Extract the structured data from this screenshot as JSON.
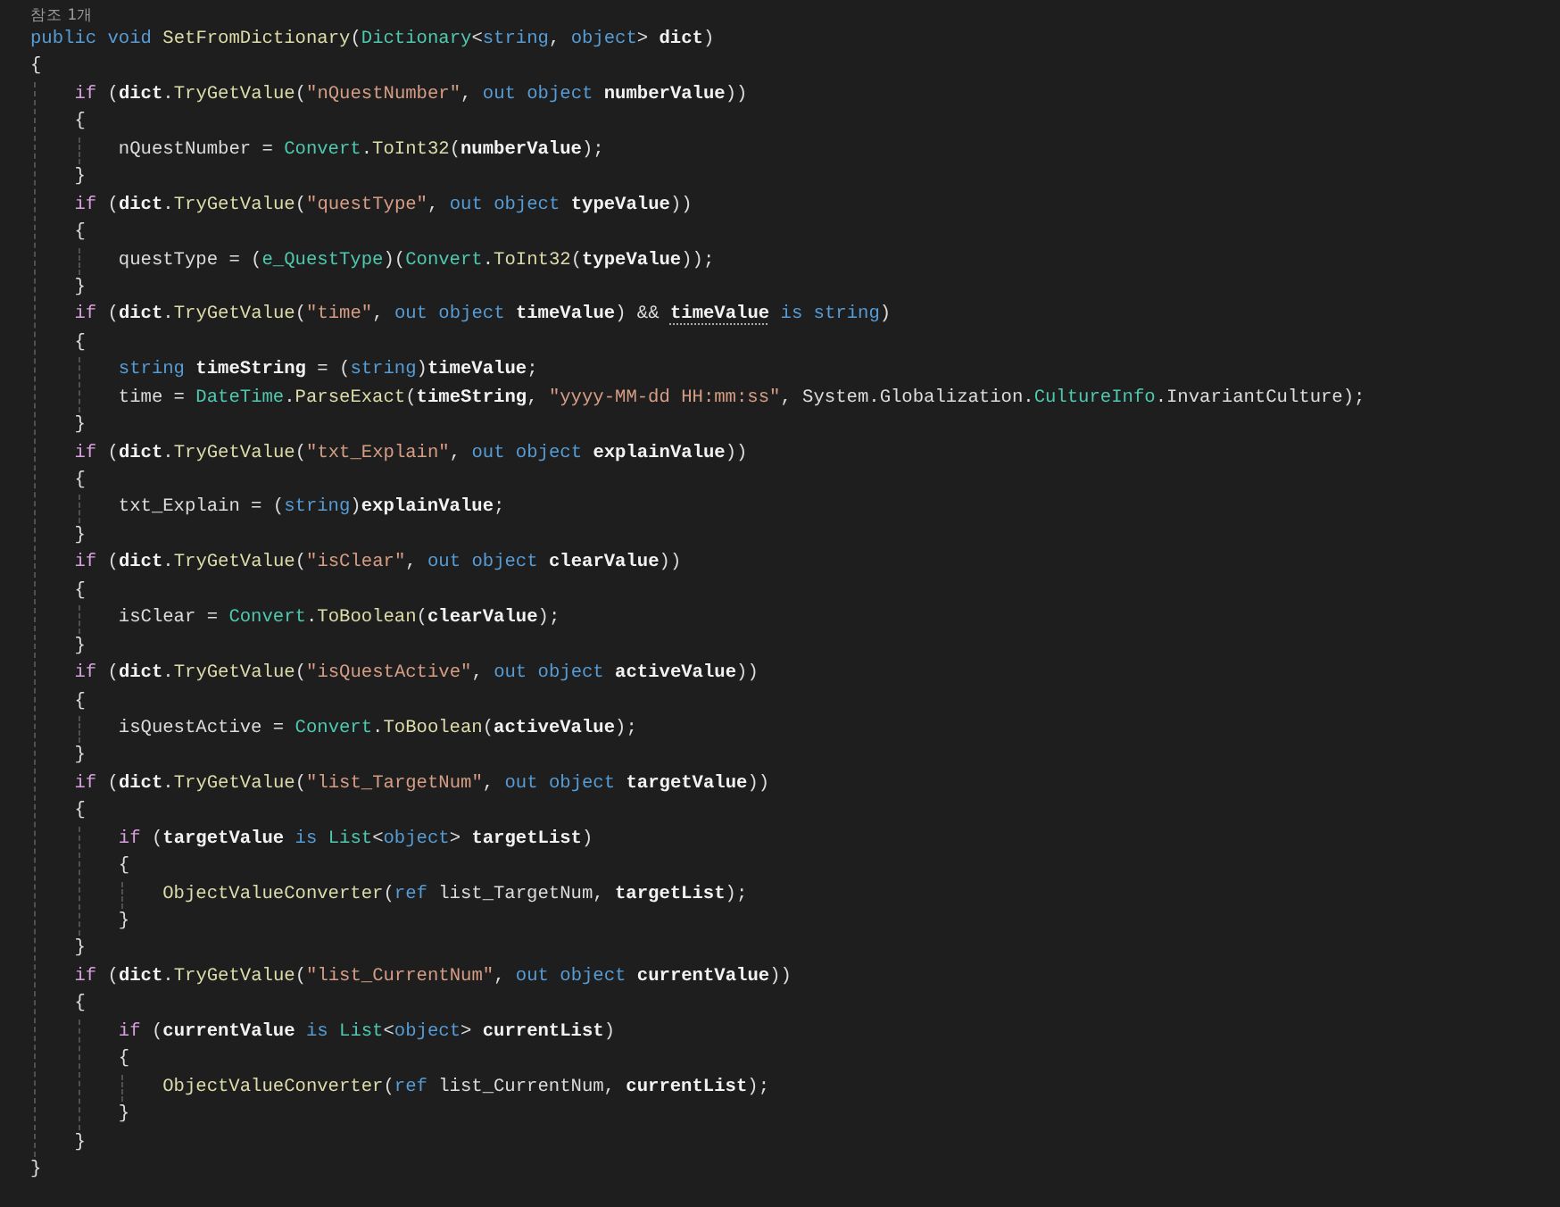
{
  "codelens": "참조 1개",
  "lines": [
    {
      "tokens": [
        {
          "kind": "kw",
          "text": "public void "
        },
        {
          "kind": "fn",
          "text": "SetFromDictionary"
        },
        {
          "kind": "plain",
          "text": "("
        },
        {
          "kind": "type",
          "text": "Dictionary"
        },
        {
          "kind": "plain",
          "text": "<"
        },
        {
          "kind": "kw",
          "text": "string"
        },
        {
          "kind": "plain",
          "text": ", "
        },
        {
          "kind": "kw",
          "text": "object"
        },
        {
          "kind": "plain",
          "text": "> "
        },
        {
          "kind": "var",
          "text": "dict"
        },
        {
          "kind": "plain",
          "text": ")"
        }
      ]
    },
    {
      "tokens": [
        {
          "kind": "plain",
          "text": "{"
        }
      ]
    },
    {
      "children": [
        {
          "tokens": [
            {
              "kind": "ctl",
              "text": "if "
            },
            {
              "kind": "plain",
              "text": "("
            },
            {
              "kind": "var",
              "text": "dict"
            },
            {
              "kind": "plain",
              "text": "."
            },
            {
              "kind": "fn",
              "text": "TryGetValue"
            },
            {
              "kind": "plain",
              "text": "("
            },
            {
              "kind": "str",
              "text": "\"nQuestNumber\""
            },
            {
              "kind": "plain",
              "text": ", "
            },
            {
              "kind": "kw",
              "text": "out object "
            },
            {
              "kind": "var",
              "text": "numberValue"
            },
            {
              "kind": "plain",
              "text": "))"
            }
          ]
        },
        {
          "tokens": [
            {
              "kind": "plain",
              "text": "{"
            }
          ]
        },
        {
          "children": [
            {
              "tokens": [
                {
                  "kind": "plain",
                  "text": "nQuestNumber = "
                },
                {
                  "kind": "type",
                  "text": "Convert"
                },
                {
                  "kind": "plain",
                  "text": "."
                },
                {
                  "kind": "fn",
                  "text": "ToInt32"
                },
                {
                  "kind": "plain",
                  "text": "("
                },
                {
                  "kind": "var",
                  "text": "numberValue"
                },
                {
                  "kind": "plain",
                  "text": ");"
                }
              ]
            }
          ]
        },
        {
          "tokens": [
            {
              "kind": "plain",
              "text": "}"
            }
          ]
        },
        {
          "tokens": [
            {
              "kind": "ctl",
              "text": "if "
            },
            {
              "kind": "plain",
              "text": "("
            },
            {
              "kind": "var",
              "text": "dict"
            },
            {
              "kind": "plain",
              "text": "."
            },
            {
              "kind": "fn",
              "text": "TryGetValue"
            },
            {
              "kind": "plain",
              "text": "("
            },
            {
              "kind": "str",
              "text": "\"questType\""
            },
            {
              "kind": "plain",
              "text": ", "
            },
            {
              "kind": "kw",
              "text": "out object "
            },
            {
              "kind": "var",
              "text": "typeValue"
            },
            {
              "kind": "plain",
              "text": "))"
            }
          ]
        },
        {
          "tokens": [
            {
              "kind": "plain",
              "text": "{"
            }
          ]
        },
        {
          "children": [
            {
              "tokens": [
                {
                  "kind": "plain",
                  "text": "questType = ("
                },
                {
                  "kind": "type",
                  "text": "e_QuestType"
                },
                {
                  "kind": "plain",
                  "text": ")("
                },
                {
                  "kind": "type",
                  "text": "Convert"
                },
                {
                  "kind": "plain",
                  "text": "."
                },
                {
                  "kind": "fn",
                  "text": "ToInt32"
                },
                {
                  "kind": "plain",
                  "text": "("
                },
                {
                  "kind": "var",
                  "text": "typeValue"
                },
                {
                  "kind": "plain",
                  "text": "));"
                }
              ]
            }
          ]
        },
        {
          "tokens": [
            {
              "kind": "plain",
              "text": "}"
            }
          ]
        },
        {
          "tokens": [
            {
              "kind": "ctl",
              "text": "if "
            },
            {
              "kind": "plain",
              "text": "("
            },
            {
              "kind": "var",
              "text": "dict"
            },
            {
              "kind": "plain",
              "text": "."
            },
            {
              "kind": "fn",
              "text": "TryGetValue"
            },
            {
              "kind": "plain",
              "text": "("
            },
            {
              "kind": "str",
              "text": "\"time\""
            },
            {
              "kind": "plain",
              "text": ", "
            },
            {
              "kind": "kw",
              "text": "out object "
            },
            {
              "kind": "var",
              "text": "timeValue"
            },
            {
              "kind": "plain",
              "text": ") && "
            },
            {
              "kind": "hint",
              "text": "timeValue"
            },
            {
              "kind": "kw",
              "text": " is string"
            },
            {
              "kind": "plain",
              "text": ")"
            }
          ]
        },
        {
          "tokens": [
            {
              "kind": "plain",
              "text": "{"
            }
          ]
        },
        {
          "children": [
            {
              "tokens": [
                {
                  "kind": "kw",
                  "text": "string "
                },
                {
                  "kind": "var",
                  "text": "timeString"
                },
                {
                  "kind": "plain",
                  "text": " = ("
                },
                {
                  "kind": "kw",
                  "text": "string"
                },
                {
                  "kind": "plain",
                  "text": ")"
                },
                {
                  "kind": "var",
                  "text": "timeValue"
                },
                {
                  "kind": "plain",
                  "text": ";"
                }
              ]
            },
            {
              "tokens": [
                {
                  "kind": "plain",
                  "text": "time = "
                },
                {
                  "kind": "type",
                  "text": "DateTime"
                },
                {
                  "kind": "plain",
                  "text": "."
                },
                {
                  "kind": "fn",
                  "text": "ParseExact"
                },
                {
                  "kind": "plain",
                  "text": "("
                },
                {
                  "kind": "var",
                  "text": "timeString"
                },
                {
                  "kind": "plain",
                  "text": ", "
                },
                {
                  "kind": "str",
                  "text": "\"yyyy-MM-dd HH:mm:ss\""
                },
                {
                  "kind": "plain",
                  "text": ", System.Globalization."
                },
                {
                  "kind": "type",
                  "text": "CultureInfo"
                },
                {
                  "kind": "plain",
                  "text": ".InvariantCulture);"
                }
              ]
            }
          ]
        },
        {
          "tokens": [
            {
              "kind": "plain",
              "text": "}"
            }
          ]
        },
        {
          "tokens": [
            {
              "kind": "ctl",
              "text": "if "
            },
            {
              "kind": "plain",
              "text": "("
            },
            {
              "kind": "var",
              "text": "dict"
            },
            {
              "kind": "plain",
              "text": "."
            },
            {
              "kind": "fn",
              "text": "TryGetValue"
            },
            {
              "kind": "plain",
              "text": "("
            },
            {
              "kind": "str",
              "text": "\"txt_Explain\""
            },
            {
              "kind": "plain",
              "text": ", "
            },
            {
              "kind": "kw",
              "text": "out object "
            },
            {
              "kind": "var",
              "text": "explainValue"
            },
            {
              "kind": "plain",
              "text": "))"
            }
          ]
        },
        {
          "tokens": [
            {
              "kind": "plain",
              "text": "{"
            }
          ]
        },
        {
          "children": [
            {
              "tokens": [
                {
                  "kind": "plain",
                  "text": "txt_Explain = ("
                },
                {
                  "kind": "kw",
                  "text": "string"
                },
                {
                  "kind": "plain",
                  "text": ")"
                },
                {
                  "kind": "var",
                  "text": "explainValue"
                },
                {
                  "kind": "plain",
                  "text": ";"
                }
              ]
            }
          ]
        },
        {
          "tokens": [
            {
              "kind": "plain",
              "text": "}"
            }
          ]
        },
        {
          "tokens": [
            {
              "kind": "ctl",
              "text": "if "
            },
            {
              "kind": "plain",
              "text": "("
            },
            {
              "kind": "var",
              "text": "dict"
            },
            {
              "kind": "plain",
              "text": "."
            },
            {
              "kind": "fn",
              "text": "TryGetValue"
            },
            {
              "kind": "plain",
              "text": "("
            },
            {
              "kind": "str",
              "text": "\"isClear\""
            },
            {
              "kind": "plain",
              "text": ", "
            },
            {
              "kind": "kw",
              "text": "out object "
            },
            {
              "kind": "var",
              "text": "clearValue"
            },
            {
              "kind": "plain",
              "text": "))"
            }
          ]
        },
        {
          "tokens": [
            {
              "kind": "plain",
              "text": "{"
            }
          ]
        },
        {
          "children": [
            {
              "tokens": [
                {
                  "kind": "plain",
                  "text": "isClear = "
                },
                {
                  "kind": "type",
                  "text": "Convert"
                },
                {
                  "kind": "plain",
                  "text": "."
                },
                {
                  "kind": "fn",
                  "text": "ToBoolean"
                },
                {
                  "kind": "plain",
                  "text": "("
                },
                {
                  "kind": "var",
                  "text": "clearValue"
                },
                {
                  "kind": "plain",
                  "text": ");"
                }
              ]
            }
          ]
        },
        {
          "tokens": [
            {
              "kind": "plain",
              "text": "}"
            }
          ]
        },
        {
          "tokens": [
            {
              "kind": "ctl",
              "text": "if "
            },
            {
              "kind": "plain",
              "text": "("
            },
            {
              "kind": "var",
              "text": "dict"
            },
            {
              "kind": "plain",
              "text": "."
            },
            {
              "kind": "fn",
              "text": "TryGetValue"
            },
            {
              "kind": "plain",
              "text": "("
            },
            {
              "kind": "str",
              "text": "\"isQuestActive\""
            },
            {
              "kind": "plain",
              "text": ", "
            },
            {
              "kind": "kw",
              "text": "out object "
            },
            {
              "kind": "var",
              "text": "activeValue"
            },
            {
              "kind": "plain",
              "text": "))"
            }
          ]
        },
        {
          "tokens": [
            {
              "kind": "plain",
              "text": "{"
            }
          ]
        },
        {
          "children": [
            {
              "tokens": [
                {
                  "kind": "plain",
                  "text": "isQuestActive = "
                },
                {
                  "kind": "type",
                  "text": "Convert"
                },
                {
                  "kind": "plain",
                  "text": "."
                },
                {
                  "kind": "fn",
                  "text": "ToBoolean"
                },
                {
                  "kind": "plain",
                  "text": "("
                },
                {
                  "kind": "var",
                  "text": "activeValue"
                },
                {
                  "kind": "plain",
                  "text": ");"
                }
              ]
            }
          ]
        },
        {
          "tokens": [
            {
              "kind": "plain",
              "text": "}"
            }
          ]
        },
        {
          "tokens": [
            {
              "kind": "ctl",
              "text": "if "
            },
            {
              "kind": "plain",
              "text": "("
            },
            {
              "kind": "var",
              "text": "dict"
            },
            {
              "kind": "plain",
              "text": "."
            },
            {
              "kind": "fn",
              "text": "TryGetValue"
            },
            {
              "kind": "plain",
              "text": "("
            },
            {
              "kind": "str",
              "text": "\"list_TargetNum\""
            },
            {
              "kind": "plain",
              "text": ", "
            },
            {
              "kind": "kw",
              "text": "out object "
            },
            {
              "kind": "var",
              "text": "targetValue"
            },
            {
              "kind": "plain",
              "text": "))"
            }
          ]
        },
        {
          "tokens": [
            {
              "kind": "plain",
              "text": "{"
            }
          ]
        },
        {
          "children": [
            {
              "tokens": [
                {
                  "kind": "ctl",
                  "text": "if "
                },
                {
                  "kind": "plain",
                  "text": "("
                },
                {
                  "kind": "var",
                  "text": "targetValue"
                },
                {
                  "kind": "kw",
                  "text": " is "
                },
                {
                  "kind": "type",
                  "text": "List"
                },
                {
                  "kind": "plain",
                  "text": "<"
                },
                {
                  "kind": "kw",
                  "text": "object"
                },
                {
                  "kind": "plain",
                  "text": "> "
                },
                {
                  "kind": "var",
                  "text": "targetList"
                },
                {
                  "kind": "plain",
                  "text": ")"
                }
              ]
            },
            {
              "tokens": [
                {
                  "kind": "plain",
                  "text": "{"
                }
              ]
            },
            {
              "children": [
                {
                  "tokens": [
                    {
                      "kind": "fn",
                      "text": "ObjectValueConverter"
                    },
                    {
                      "kind": "plain",
                      "text": "("
                    },
                    {
                      "kind": "kw",
                      "text": "ref "
                    },
                    {
                      "kind": "plain",
                      "text": "list_TargetNum, "
                    },
                    {
                      "kind": "var",
                      "text": "targetList"
                    },
                    {
                      "kind": "plain",
                      "text": ");"
                    }
                  ]
                }
              ]
            },
            {
              "tokens": [
                {
                  "kind": "plain",
                  "text": "}"
                }
              ]
            }
          ]
        },
        {
          "tokens": [
            {
              "kind": "plain",
              "text": "}"
            }
          ]
        },
        {
          "tokens": [
            {
              "kind": "ctl",
              "text": "if "
            },
            {
              "kind": "plain",
              "text": "("
            },
            {
              "kind": "var",
              "text": "dict"
            },
            {
              "kind": "plain",
              "text": "."
            },
            {
              "kind": "fn",
              "text": "TryGetValue"
            },
            {
              "kind": "plain",
              "text": "("
            },
            {
              "kind": "str",
              "text": "\"list_CurrentNum\""
            },
            {
              "kind": "plain",
              "text": ", "
            },
            {
              "kind": "kw",
              "text": "out object "
            },
            {
              "kind": "var",
              "text": "currentValue"
            },
            {
              "kind": "plain",
              "text": "))"
            }
          ]
        },
        {
          "tokens": [
            {
              "kind": "plain",
              "text": "{"
            }
          ]
        },
        {
          "children": [
            {
              "tokens": [
                {
                  "kind": "ctl",
                  "text": "if "
                },
                {
                  "kind": "plain",
                  "text": "("
                },
                {
                  "kind": "var",
                  "text": "currentValue"
                },
                {
                  "kind": "kw",
                  "text": " is "
                },
                {
                  "kind": "type",
                  "text": "List"
                },
                {
                  "kind": "plain",
                  "text": "<"
                },
                {
                  "kind": "kw",
                  "text": "object"
                },
                {
                  "kind": "plain",
                  "text": "> "
                },
                {
                  "kind": "var",
                  "text": "currentList"
                },
                {
                  "kind": "plain",
                  "text": ")"
                }
              ]
            },
            {
              "tokens": [
                {
                  "kind": "plain",
                  "text": "{"
                }
              ]
            },
            {
              "children": [
                {
                  "tokens": [
                    {
                      "kind": "fn",
                      "text": "ObjectValueConverter"
                    },
                    {
                      "kind": "plain",
                      "text": "("
                    },
                    {
                      "kind": "kw",
                      "text": "ref "
                    },
                    {
                      "kind": "plain",
                      "text": "list_CurrentNum, "
                    },
                    {
                      "kind": "var",
                      "text": "currentList"
                    },
                    {
                      "kind": "plain",
                      "text": ");"
                    }
                  ]
                }
              ]
            },
            {
              "tokens": [
                {
                  "kind": "plain",
                  "text": "}"
                }
              ]
            }
          ]
        },
        {
          "tokens": [
            {
              "kind": "plain",
              "text": "}"
            }
          ]
        }
      ]
    },
    {
      "tokens": [
        {
          "kind": "plain",
          "text": "}"
        }
      ]
    }
  ]
}
